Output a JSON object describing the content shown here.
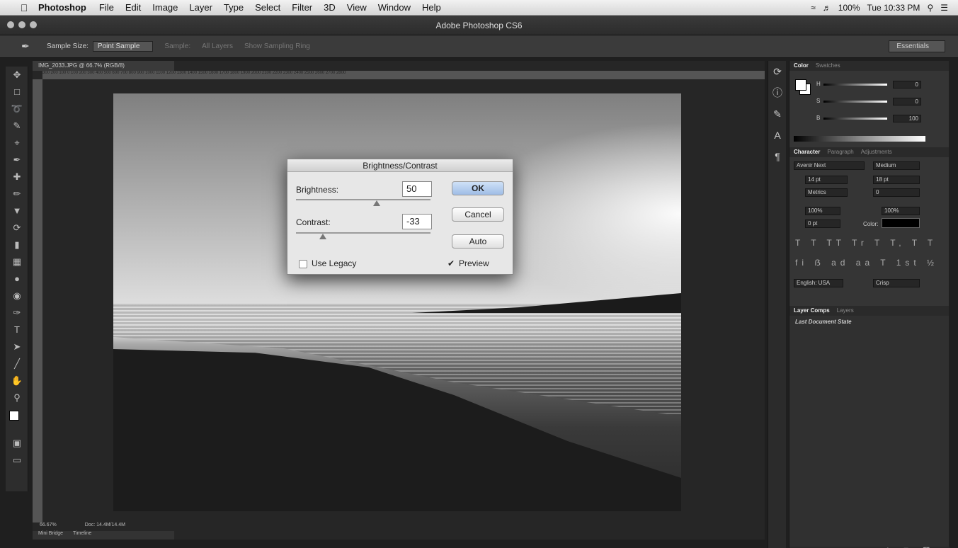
{
  "menubar": {
    "app": "Photoshop",
    "items": [
      "File",
      "Edit",
      "Image",
      "Layer",
      "Type",
      "Select",
      "Filter",
      "3D",
      "View",
      "Window",
      "Help"
    ],
    "battery": "100%",
    "clock": "Tue 10:33 PM"
  },
  "window": {
    "title": "Adobe Photoshop CS6"
  },
  "options": {
    "sample_size_label": "Sample Size:",
    "sample_size_value": "Point Sample",
    "sample_label": "Sample:",
    "sample_value": "All Layers",
    "sampling_ring": "Show Sampling Ring",
    "workspace": "Essentials"
  },
  "document": {
    "tab": "IMG_2033.JPG @ 66.7% (RGB/8)",
    "ruler_ticks": "300 200 100 0 100 200 300 400 500 600 700 800 900 1000 1100 1200 1300 1400 1500 1600 1700 1800 1900 2000 2100 2200 2300 2400 2500 2600 2700 2800",
    "zoom": "66.67%",
    "doc_size": "Doc: 14.4M/14.4M"
  },
  "bottom_tabs": [
    "Mini Bridge",
    "Timeline"
  ],
  "dialog": {
    "title": "Brightness/Contrast",
    "brightness_label": "Brightness:",
    "brightness_value": "50",
    "contrast_label": "Contrast:",
    "contrast_value": "-33",
    "brightness_level": 0.6,
    "contrast_level": 0.2,
    "ok": "OK",
    "cancel": "Cancel",
    "auto": "Auto",
    "use_legacy": "Use Legacy",
    "preview": "Preview",
    "use_legacy_checked": false,
    "preview_checked": true
  },
  "color_panel": {
    "tabs": [
      "Color",
      "Swatches"
    ],
    "h_label": "H",
    "s_label": "S",
    "b_label": "B",
    "h_value": "0",
    "s_value": "0",
    "b_value": "100"
  },
  "character_panel": {
    "tabs": [
      "Character",
      "Paragraph",
      "Adjustments"
    ],
    "font_family": "Avenir Next",
    "font_style": "Medium",
    "size": "14 pt",
    "leading": "18 pt",
    "kerning": "Metrics",
    "tracking": "0",
    "vscale": "100%",
    "hscale": "100%",
    "baseline": "0 pt",
    "color_label": "Color:",
    "language": "English: USA",
    "antialias": "Crisp"
  },
  "layers_panel": {
    "tabs": [
      "Layer Comps",
      "Layers"
    ],
    "item": "Last Document State"
  }
}
